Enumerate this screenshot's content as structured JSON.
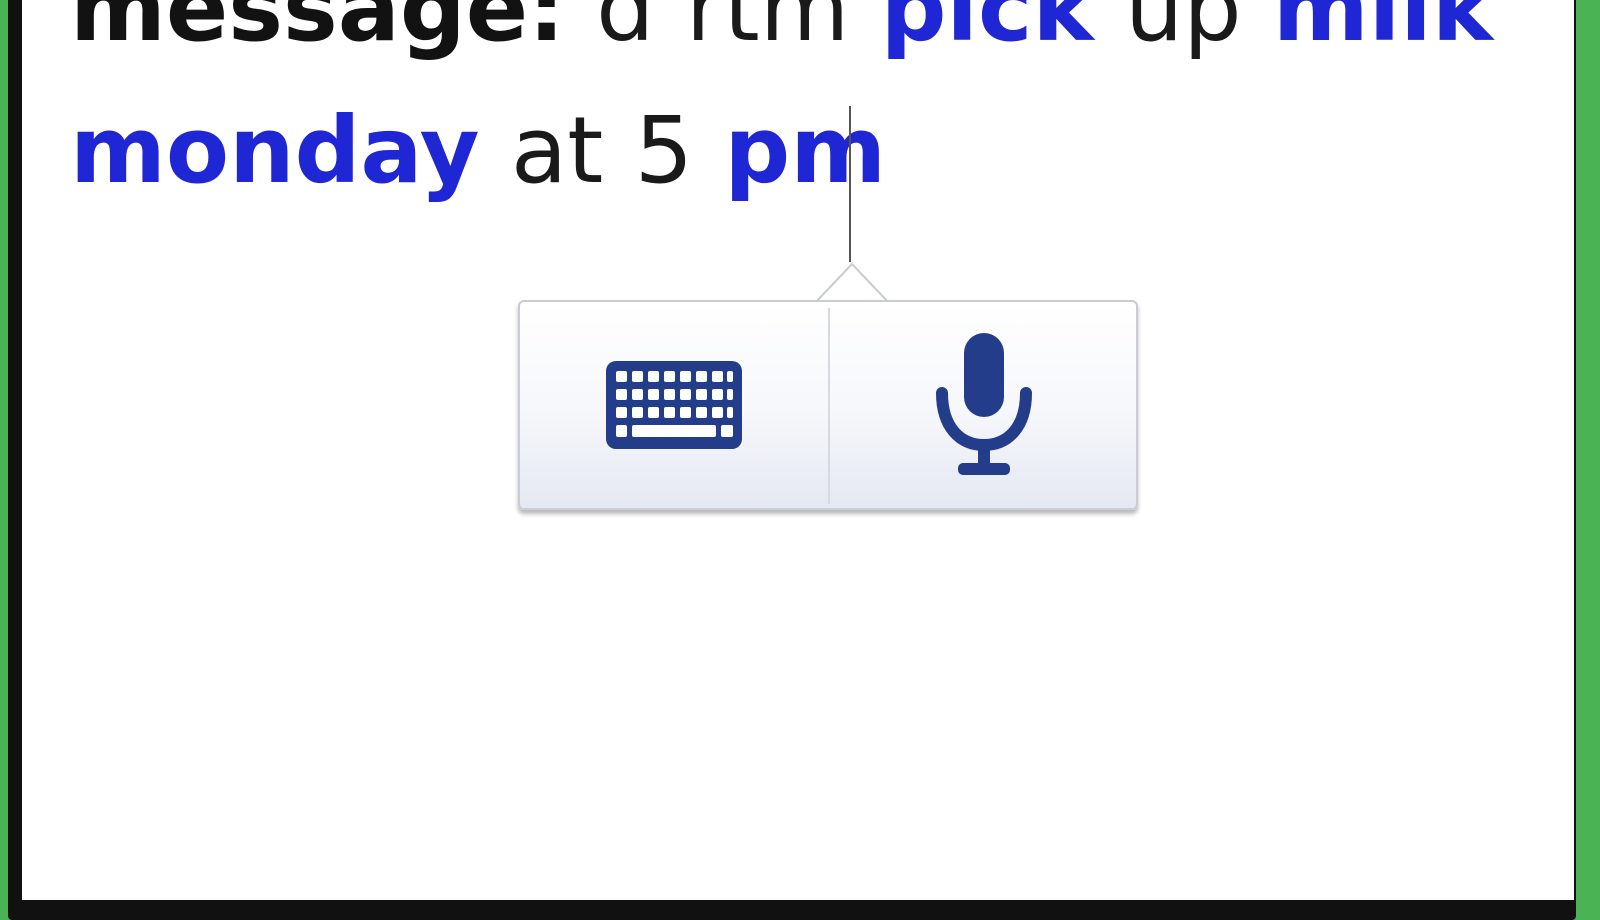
{
  "message": {
    "label": "message:",
    "tokens": [
      {
        "text": "d rtm",
        "type": "plain"
      },
      {
        "text": "pick",
        "type": "keyword"
      },
      {
        "text": "up",
        "type": "plain"
      },
      {
        "text": "milk",
        "type": "keyword"
      },
      {
        "text": "monday",
        "type": "keyword"
      },
      {
        "text": "at 5",
        "type": "plain"
      },
      {
        "text": "pm",
        "type": "keyword"
      }
    ]
  },
  "input_popup": {
    "options": [
      {
        "name": "keyboard-option",
        "icon": "keyboard-icon"
      },
      {
        "name": "voice-option",
        "icon": "microphone-icon"
      }
    ]
  },
  "colors": {
    "keyword": "#1f26d4",
    "icon": "#233d8b",
    "frame_green": "#4ab455"
  }
}
